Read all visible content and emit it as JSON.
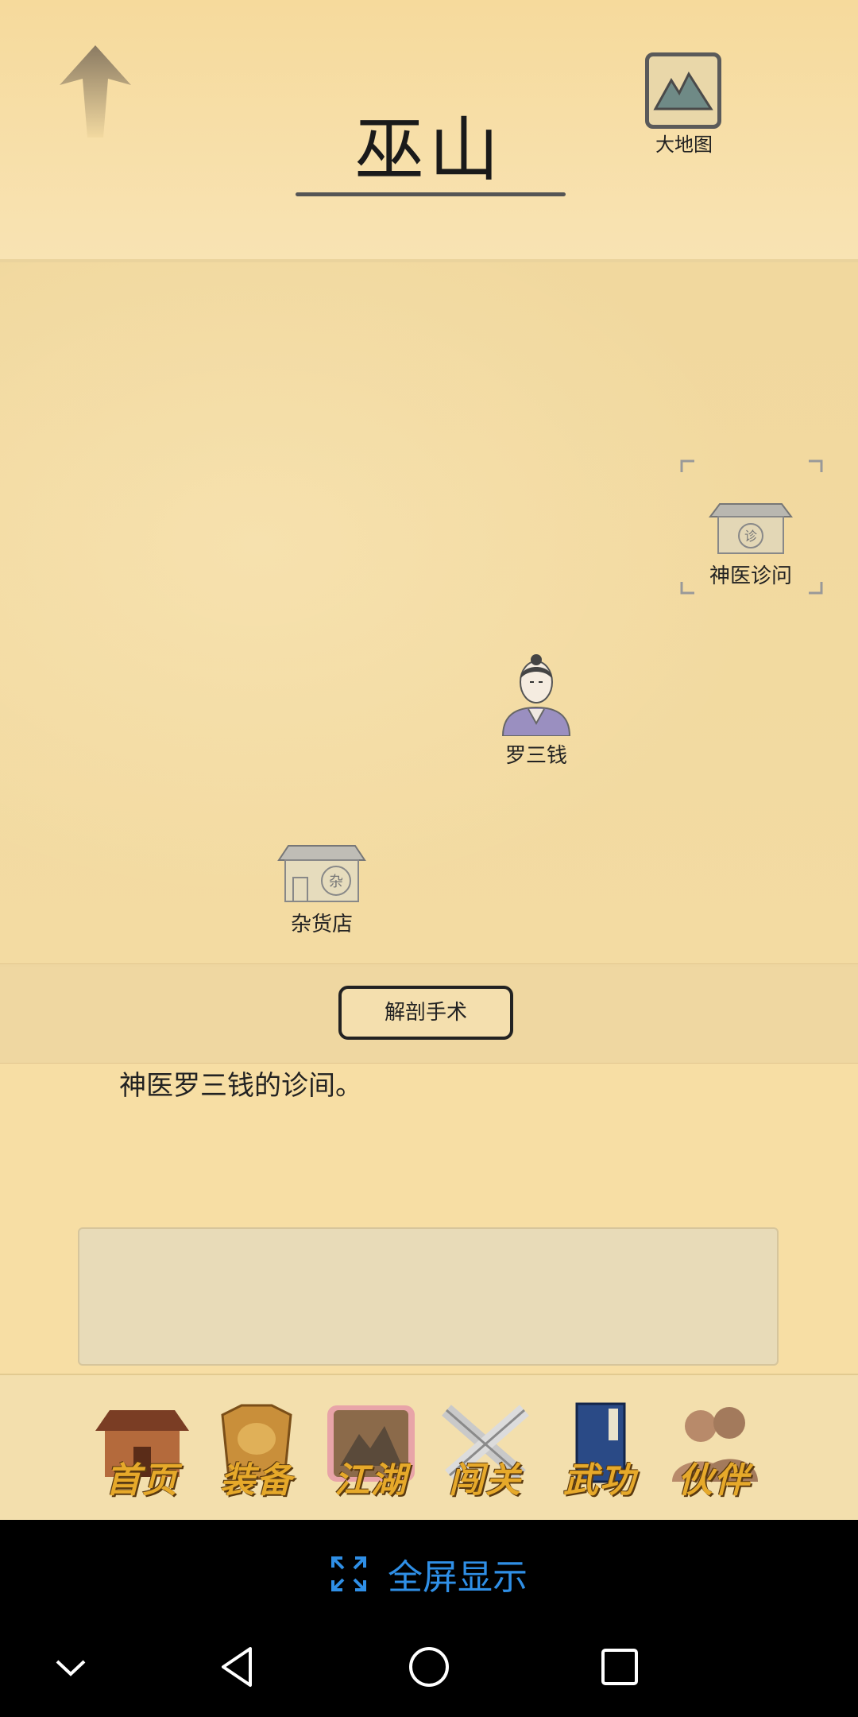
{
  "header": {
    "title": "巫山",
    "map_button_label": "大地图"
  },
  "map": {
    "pois": [
      {
        "label": "神医诊问",
        "badge": "诊"
      },
      {
        "label": "罗三钱"
      },
      {
        "label": "杂货店",
        "badge": "杂"
      }
    ],
    "action_button": "解剖手术"
  },
  "description": "神医罗三钱的诊间。",
  "bottom_nav": {
    "items": [
      {
        "label": "首页",
        "icon": "home-building-icon"
      },
      {
        "label": "装备",
        "icon": "armor-icon"
      },
      {
        "label": "江湖",
        "icon": "scroll-map-icon",
        "active": true
      },
      {
        "label": "闯关",
        "icon": "crossed-swords-icon"
      },
      {
        "label": "武功",
        "icon": "book-icon"
      },
      {
        "label": "伙伴",
        "icon": "companions-icon"
      }
    ]
  },
  "system": {
    "fullscreen_label": "全屏显示"
  },
  "colors": {
    "accent_blue": "#2f8fe6",
    "nav_gold": "#e6a92a",
    "paper": "#f3dba2"
  }
}
